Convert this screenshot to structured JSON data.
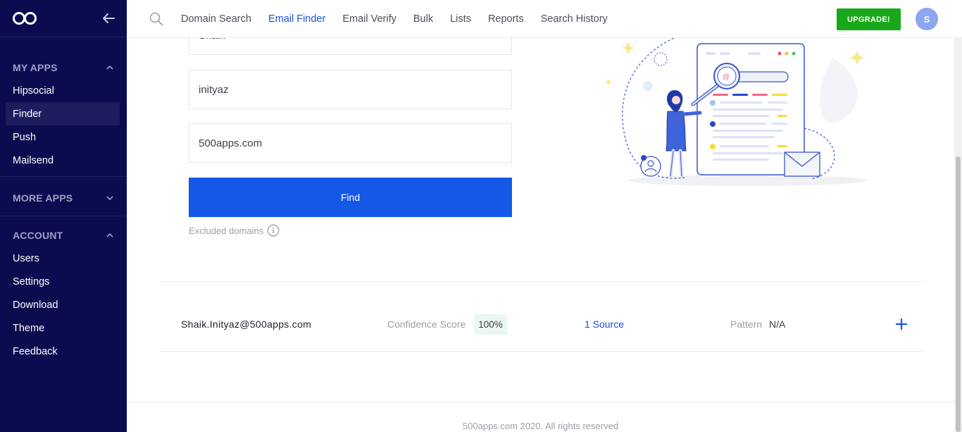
{
  "sidebar": {
    "logo_icon": "infinity-logo-icon",
    "sections": {
      "my_apps": {
        "title": "MY APPS",
        "items": [
          "Hipsocial",
          "Finder",
          "Push",
          "Mailsend"
        ],
        "active": "Finder"
      },
      "more_apps": {
        "title": "MORE APPS"
      },
      "account": {
        "title": "ACCOUNT",
        "items": [
          "Users",
          "Settings",
          "Download",
          "Theme",
          "Feedback"
        ]
      }
    }
  },
  "topnav": {
    "items": [
      "Domain Search",
      "Email Finder",
      "Email Verify",
      "Bulk",
      "Lists",
      "Reports",
      "Search History"
    ],
    "active": "Email Finder",
    "upgrade_label": "UPGRADE!",
    "avatar_initial": "S"
  },
  "form": {
    "first_name_value": "Shaik",
    "last_name_value": "inityaz",
    "domain_value": "500apps.com",
    "find_label": "Find",
    "excluded_label": "Excluded domains"
  },
  "result": {
    "email": "Shaik.Inityaz@500apps.com",
    "confidence_label": "Confidence Score",
    "confidence_value": "100%",
    "sources": "1 Source",
    "pattern_label": "Pattern",
    "pattern_value": "N/A"
  },
  "footer": {
    "text": "500apps.com 2020. All rights reserved"
  },
  "colors": {
    "sidebar_bg": "#0b0b4f",
    "accent_blue": "#1558e6",
    "upgrade_green": "#1aa81a",
    "avatar_bg": "#8ea6f0"
  }
}
